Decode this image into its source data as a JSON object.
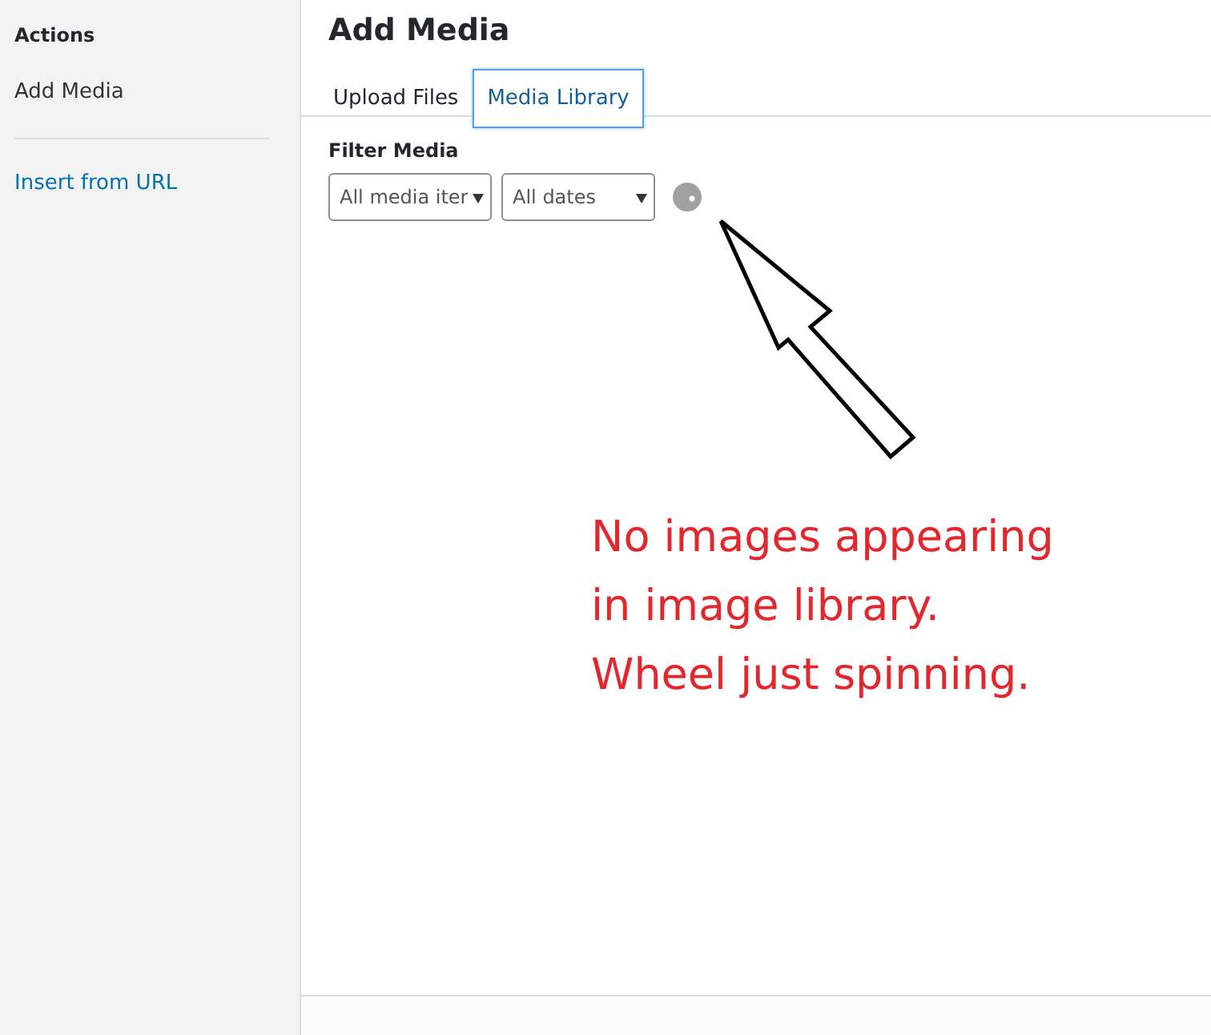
{
  "sidebar": {
    "heading": "Actions",
    "items": [
      {
        "label": "Add Media",
        "kind": "current"
      },
      {
        "label": "Insert from URL",
        "kind": "link"
      }
    ]
  },
  "title": "Add Media",
  "tabs": [
    {
      "label": "Upload Files",
      "selected": false
    },
    {
      "label": "Media Library",
      "selected": true
    }
  ],
  "filter": {
    "label": "Filter Media",
    "selects": [
      {
        "value": "All media iter"
      },
      {
        "value": "All dates"
      }
    ]
  },
  "annotation": {
    "lines": [
      "No images appearing",
      "in image library.",
      "Wheel just spinning."
    ]
  }
}
